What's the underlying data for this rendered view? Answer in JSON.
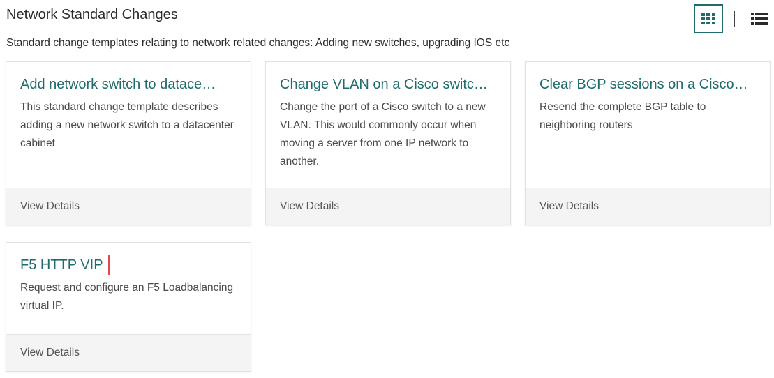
{
  "category": {
    "title": "Network Standard Changes",
    "description": "Standard change templates relating to network related changes: Adding new switches, upgrading IOS etc"
  },
  "view_toggle": {
    "grid_icon": "grid-icon",
    "list_icon": "list-icon",
    "active": "grid",
    "accent_color": "#1f6b6d"
  },
  "cards": [
    {
      "title": "Add network switch to datace…",
      "description": "This standard change template describes adding a new network switch to a datacenter cabinet",
      "footer": "View Details"
    },
    {
      "title": "Change VLAN on a Cisco switc…",
      "description": "Change the port of a Cisco switch to a new VLAN. This would commonly occur when moving a server from one IP network to another.",
      "footer": "View Details"
    },
    {
      "title": "Clear BGP sessions on a Cisco…",
      "description": "Resend the complete BGP table to neighboring routers",
      "footer": "View Details"
    },
    {
      "title": "F5 HTTP VIP",
      "description": "Request and configure an F5 Loadbalancing virtual IP.",
      "footer": "View Details",
      "highlight_color": "#e8464b"
    }
  ],
  "colors": {
    "title_link": "#1f6b6d",
    "footer_bg": "#f4f4f4",
    "highlight": "#e8464b"
  }
}
